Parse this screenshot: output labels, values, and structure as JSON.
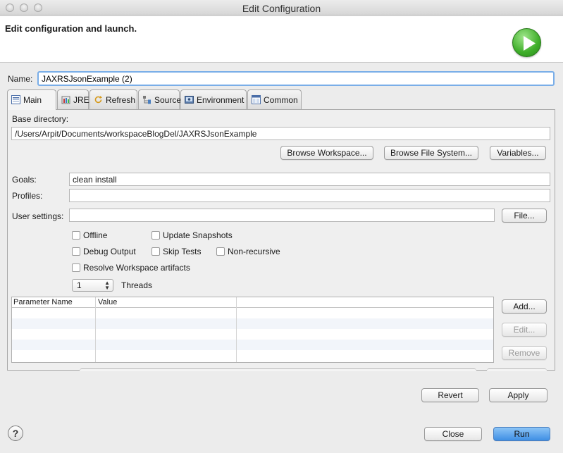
{
  "window": {
    "title": "Edit Configuration"
  },
  "header": {
    "title": "Edit configuration and launch."
  },
  "name": {
    "label": "Name:",
    "value": "JAXRSJsonExample (2)"
  },
  "tabs": [
    {
      "label": "Main",
      "icon": "main-tab-icon",
      "active": true
    },
    {
      "label": "JRE",
      "icon": "jre-icon"
    },
    {
      "label": "Refresh",
      "icon": "refresh-icon"
    },
    {
      "label": "Source",
      "icon": "source-icon"
    },
    {
      "label": "Environment",
      "icon": "environment-icon"
    },
    {
      "label": "Common",
      "icon": "common-icon"
    }
  ],
  "main": {
    "base_dir_label": "Base directory:",
    "base_dir_value": "/Users/Arpit/Documents/workspaceBlogDel/JAXRSJsonExample",
    "browse_workspace": "Browse Workspace...",
    "browse_file_system": "Browse File System...",
    "variables": "Variables...",
    "goals_label": "Goals:",
    "goals_value": "clean install",
    "profiles_label": "Profiles:",
    "profiles_value": "",
    "user_settings_label": "User settings:",
    "user_settings_value": "",
    "file_button": "File...",
    "options": {
      "offline": "Offline",
      "update_snapshots": "Update Snapshots",
      "debug_output": "Debug Output",
      "skip_tests": "Skip Tests",
      "non_recursive": "Non-recursive",
      "resolve_workspace": "Resolve Workspace artifacts"
    },
    "threads_value": "1",
    "threads_label": "Threads",
    "table": {
      "headers": [
        "Parameter Name",
        "Value"
      ]
    },
    "add_button": "Add...",
    "edit_button": "Edit...",
    "remove_button": "Remove"
  },
  "footer": {
    "revert": "Revert",
    "apply": "Apply",
    "close": "Close",
    "run": "Run",
    "help": "?"
  },
  "colors": {
    "accent": "#3f8fe4",
    "run_icon": "#3fae2a",
    "focus_ring": "#7aaee8"
  }
}
